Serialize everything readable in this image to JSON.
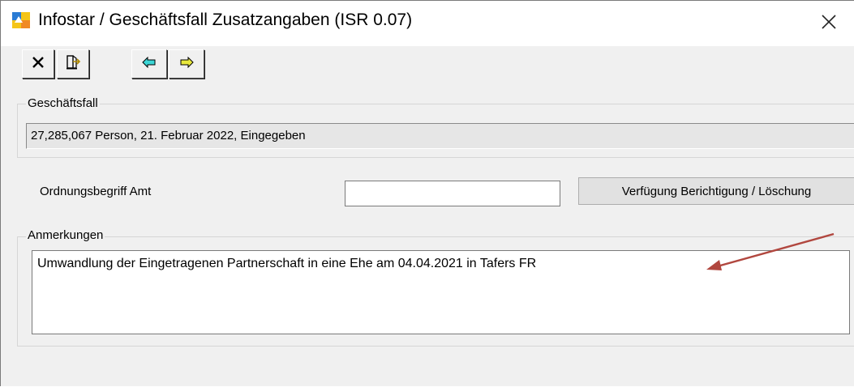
{
  "window": {
    "title": "Infostar / Geschäftsfall Zusatzangaben (ISR 0.07)",
    "accent_color": "#b1473f"
  },
  "toolbar": {
    "buttons": [
      {
        "icon": "close-x-icon"
      },
      {
        "icon": "exit-door-icon"
      },
      {
        "icon": "arrow-left-icon"
      },
      {
        "icon": "arrow-right-icon"
      }
    ]
  },
  "geschaeftsfall": {
    "legend": "Geschäftsfall",
    "value": "27,285,067  Person, 21. Februar 2022, Eingegeben"
  },
  "ordnungsbegriff": {
    "label": "Ordnungsbegriff Amt",
    "value": ""
  },
  "verfuegung_button": {
    "label": "Verfügung Berichtigung / Löschung"
  },
  "anmerkungen": {
    "legend": "Anmerkungen",
    "text": "Umwandlung der Eingetragenen Partnerschaft in eine Ehe am 04.04.2021 in Tafers FR"
  }
}
